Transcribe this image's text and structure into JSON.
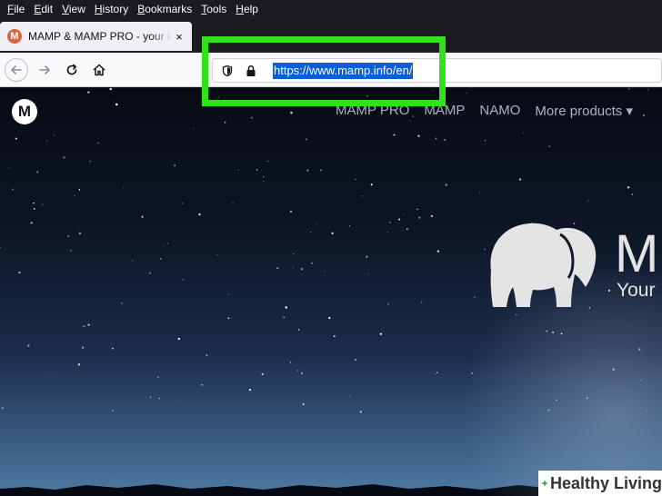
{
  "menubar": {
    "items": [
      {
        "label": "File",
        "accel": "F",
        "rest": "ile"
      },
      {
        "label": "Edit",
        "accel": "E",
        "rest": "dit"
      },
      {
        "label": "View",
        "accel": "V",
        "rest": "iew"
      },
      {
        "label": "History",
        "accel": "H",
        "rest": "istory"
      },
      {
        "label": "Bookmarks",
        "accel": "B",
        "rest": "ookmarks"
      },
      {
        "label": "Tools",
        "accel": "T",
        "rest": "ools"
      },
      {
        "label": "Help",
        "accel": "H",
        "rest": "elp"
      }
    ]
  },
  "tab": {
    "title": "MAMP & MAMP PRO - your local web development solution",
    "favicon_letter": "M",
    "close": "×"
  },
  "urlbar": {
    "url": "https://www.mamp.info/en/"
  },
  "site": {
    "logo_letter": "M",
    "nav": [
      "MAMP PRO",
      "MAMP",
      "NAMO",
      "More products ▾"
    ],
    "hero_title": "M",
    "hero_subtitle": "Your"
  },
  "watermark": {
    "text": "Healthy Living"
  },
  "colors": {
    "highlight": "#2fe21a",
    "url_selection": "#0a5fd6",
    "favicon": "#d96440"
  }
}
